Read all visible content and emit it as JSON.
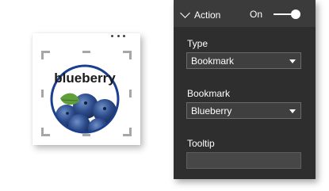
{
  "visual": {
    "image_text": "blueberry",
    "more_options_icon": "ellipsis-icon"
  },
  "action_pane": {
    "section_title": "Action",
    "toggle_label": "On",
    "toggle_on": true,
    "fields": {
      "type_label": "Type",
      "type_value": "Bookmark",
      "bookmark_label": "Bookmark",
      "bookmark_value": "Blueberry",
      "tooltip_label": "Tooltip",
      "tooltip_value": ""
    }
  },
  "colors": {
    "pane_background": "#2e2e2e",
    "header_background": "#3b3b3b",
    "dropdown_background": "#3f3f3f",
    "berry_blue": "#2b4e8f",
    "ring_blue": "#1a3f8f"
  }
}
